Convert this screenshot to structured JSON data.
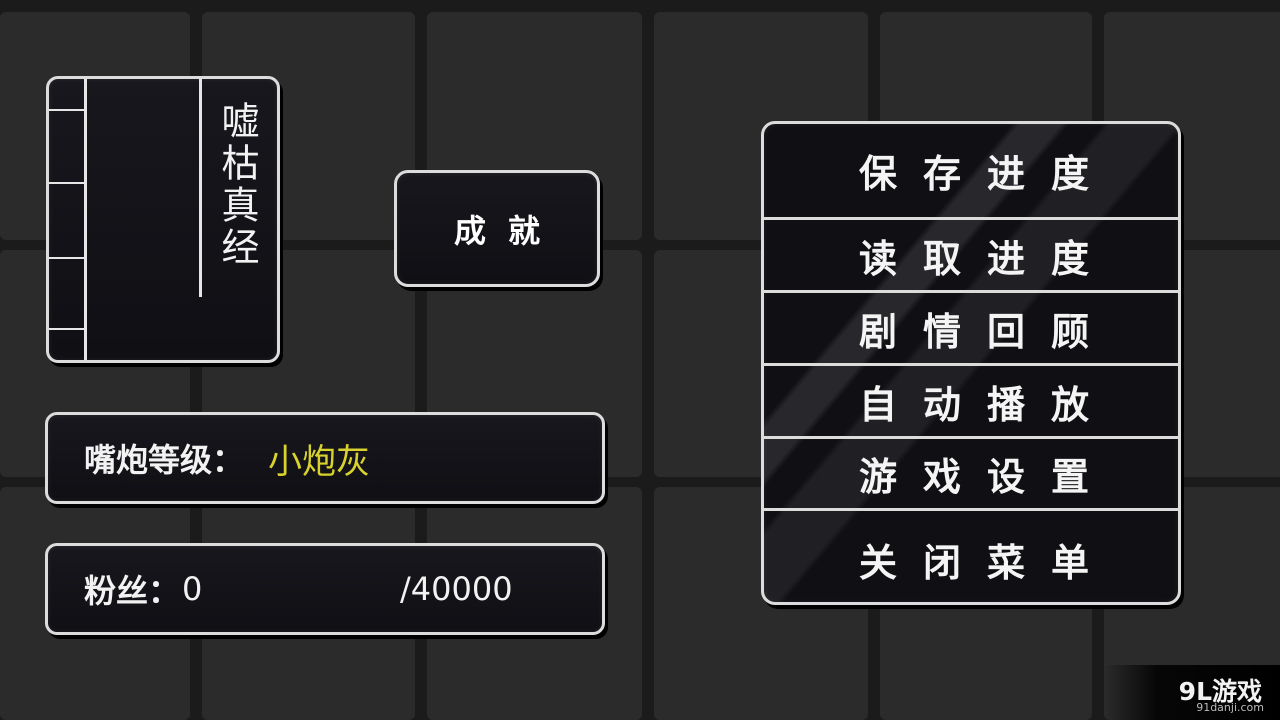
{
  "book": {
    "title": "嘘枯真经"
  },
  "achievement": {
    "label": "成就"
  },
  "level": {
    "label": "嘴炮等级：",
    "value": "小炮灰"
  },
  "fans": {
    "label": "粉丝：",
    "current": "0",
    "max": "/40000"
  },
  "menu": {
    "items": [
      {
        "label": "保存进度"
      },
      {
        "label": "读取进度"
      },
      {
        "label": "剧情回顾"
      },
      {
        "label": "自动播放"
      },
      {
        "label": "游戏设置"
      },
      {
        "label": "关闭菜单"
      }
    ]
  },
  "watermark": {
    "logo": "9L游戏",
    "site": "91danji.com"
  },
  "colors": {
    "background": "#1b1b1b",
    "grid_cell": "#2b2b2b",
    "panel": "#111116",
    "border": "#dcdcdc",
    "level_value": "#d9d22e"
  }
}
